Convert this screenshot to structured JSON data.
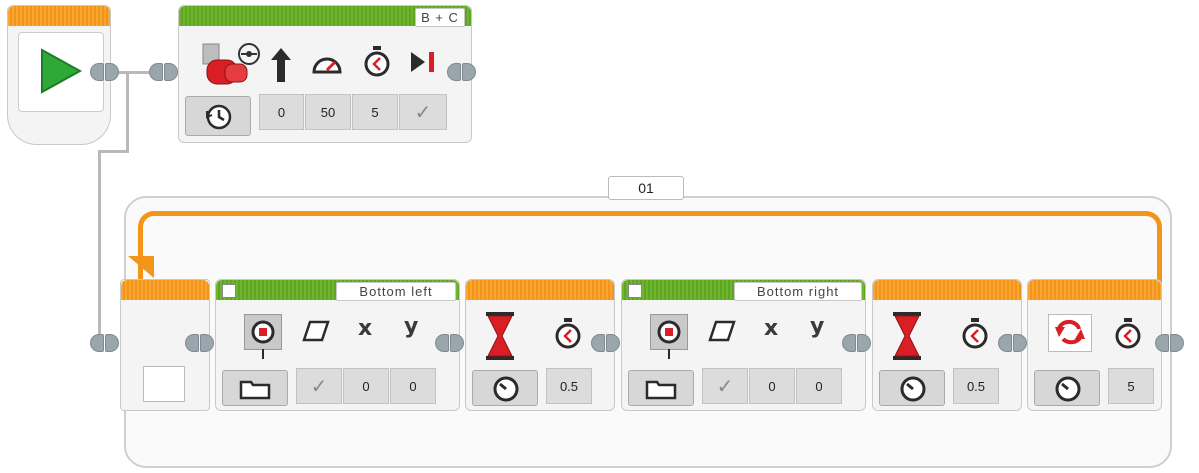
{
  "start_block": {
    "icon": "play-icon"
  },
  "motor_block": {
    "ports": "B + C",
    "mode_icon": "clock-icon",
    "params": [
      {
        "icon": "arrow-up-icon",
        "value": "0"
      },
      {
        "icon": "speedometer-icon",
        "value": "50"
      },
      {
        "icon": "stopwatch-icon",
        "value": "5"
      },
      {
        "icon": "brake-icon",
        "value": "✓"
      }
    ]
  },
  "loop": {
    "name": "01"
  },
  "display_left": {
    "label": "Bottom left",
    "params": [
      {
        "icon": "eraser-icon",
        "value": "✓"
      },
      {
        "icon": "x-icon",
        "label": "x",
        "value": "0"
      },
      {
        "icon": "y-icon",
        "label": "y",
        "value": "0"
      }
    ]
  },
  "wait_1": {
    "value": "0.5"
  },
  "display_right": {
    "label": "Bottom right",
    "params": [
      {
        "icon": "eraser-icon",
        "value": "✓"
      },
      {
        "icon": "x-icon",
        "label": "x",
        "value": "0"
      },
      {
        "icon": "y-icon",
        "label": "y",
        "value": "0"
      }
    ]
  },
  "wait_2": {
    "value": "0.5"
  },
  "loop_end": {
    "value": "5"
  },
  "colors": {
    "green": "#6fb62e",
    "orange": "#f39518",
    "red": "#e0191f",
    "gray": "#9aa6ad"
  }
}
